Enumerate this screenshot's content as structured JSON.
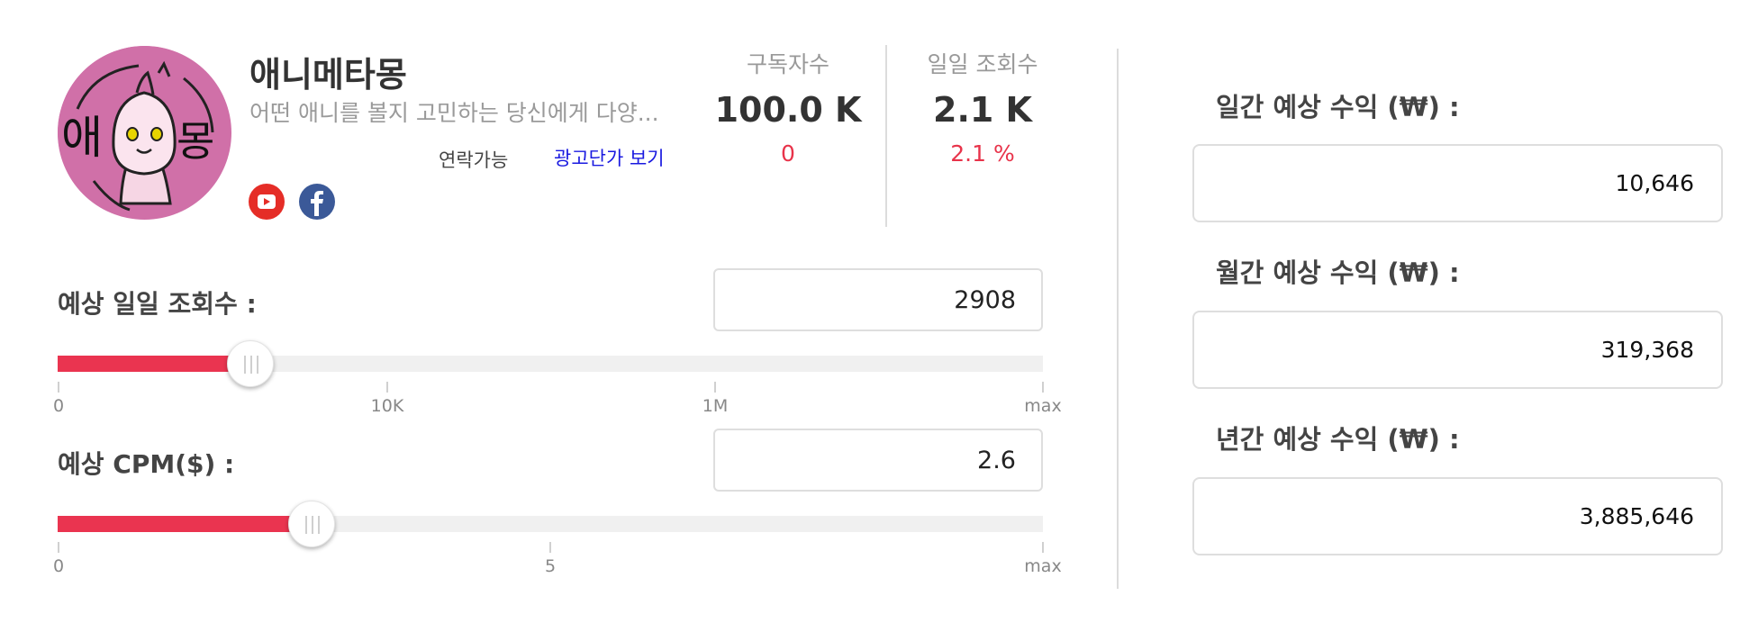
{
  "channel": {
    "name": "애니메타몽",
    "description": "어떤 애니를 볼지 고민하는 당신에게 다양...",
    "contact_label": "연락가능",
    "ad_price_link": "광고단가 보기",
    "avatar_text": "애몽",
    "social": [
      {
        "name": "youtube-icon",
        "glyph": "▶"
      },
      {
        "name": "facebook-icon",
        "glyph": "f"
      }
    ]
  },
  "stats": {
    "subscribers": {
      "label": "구독자수",
      "value": "100.0 K",
      "change": "0"
    },
    "daily_views": {
      "label": "일일 조회수",
      "value": "2.1 K",
      "change": "2.1 %"
    }
  },
  "estimator": {
    "daily_views": {
      "label": "예상 일일 조회수 :",
      "value": "2908",
      "ticks": [
        "0",
        "10K",
        "1M",
        "max"
      ],
      "fill_fraction": 0.196
    },
    "cpm": {
      "label": "예상 CPM($) :",
      "value": "2.6",
      "ticks": [
        "0",
        "5",
        "max"
      ],
      "fill_fraction": 0.258
    }
  },
  "revenue": {
    "daily": {
      "label": "일간 예상 수익 (₩) :",
      "value": "10,646"
    },
    "monthly": {
      "label": "월간 예상 수익 (₩) :",
      "value": "319,368"
    },
    "yearly": {
      "label": "년간 예상 수익 (₩) :",
      "value": "3,885,646"
    }
  },
  "colors": {
    "accent": "#ea3450",
    "link": "#1a1ae0",
    "avatar_bg": "#d070a8",
    "youtube": "#e52d27",
    "facebook": "#3b5998"
  }
}
